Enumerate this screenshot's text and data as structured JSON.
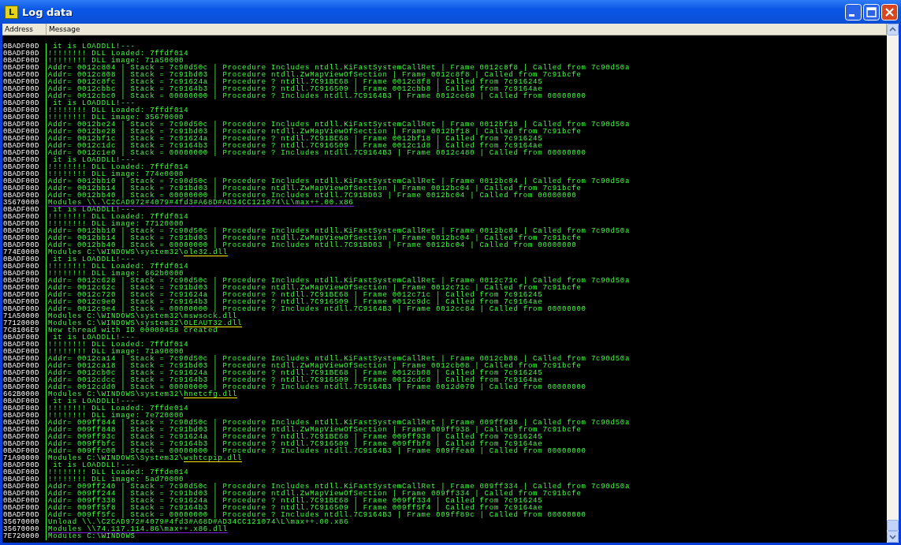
{
  "window": {
    "title": "Log data",
    "icon_letter": "L"
  },
  "columns": [
    "Address",
    "Message"
  ],
  "rows": [
    {
      "address": "0BADF00D",
      "message": " it is LOADDLL!---"
    },
    {
      "address": "0BADF00D",
      "message": "!!!!!!!! DLL Loaded: 7ffdf014"
    },
    {
      "address": "0BADF00D",
      "message": "!!!!!!!! DLL image: 71a50000"
    },
    {
      "address": "0BADF00D",
      "message": "Addr= 0012c804 | Stack = 7c90d50c | Procedure Includes ntdll.KiFastSystemCallRet | Frame 0012c8f8 | Called from 7c90d50a"
    },
    {
      "address": "0BADF00D",
      "message": "Addr= 0012c808 | Stack = 7c91bd03 | Procedure ntdll.ZwMapViewOfSection | Frame 0012c8f8 | Called from 7c91bcfe"
    },
    {
      "address": "0BADF00D",
      "message": "Addr= 0012c8fc | Stack = 7c91624a | Procedure ? ntdll.7C91BE68 | Frame 0012c8f8 | Called from 7c916245"
    },
    {
      "address": "0BADF00D",
      "message": "Addr= 0012cbbc | Stack = 7c9164b3 | Procedure ? ntdll.7C916509 | Frame 0012cbb8 | Called from 7c9164ae"
    },
    {
      "address": "0BADF00D",
      "message": "Addr= 0012cbc0 | Stack = 00000000 | Procedure ? Includes ntdll.7C9164B3 | Frame 0012ce60 | Called from 00000000"
    },
    {
      "address": "0BADF00D",
      "message": " it is LOADDLL!---"
    },
    {
      "address": "0BADF00D",
      "message": "!!!!!!!! DLL Loaded: 7ffdf014"
    },
    {
      "address": "0BADF00D",
      "message": "!!!!!!!! DLL image: 35670000"
    },
    {
      "address": "0BADF00D",
      "message": "Addr= 0012be24 | Stack = 7c90d50c | Procedure Includes ntdll.KiFastSystemCallRet | Frame 0012bf18 | Called from 7c90d50a"
    },
    {
      "address": "0BADF00D",
      "message": "Addr= 0012be28 | Stack = 7c91bd03 | Procedure ntdll.ZwMapViewOfSection | Frame 0012bf18 | Called from 7c91bcfe"
    },
    {
      "address": "0BADF00D",
      "message": "Addr= 0012bf1c | Stack = 7c91624a | Procedure ? ntdll.7C91BE68 | Frame 0012bf18 | Called from 7c916245"
    },
    {
      "address": "0BADF00D",
      "message": "Addr= 0012c1dc | Stack = 7c9164b3 | Procedure ? ntdll.7C916509 | Frame 0012c1d8 | Called from 7c9164ae"
    },
    {
      "address": "0BADF00D",
      "message": "Addr= 0012c1e0 | Stack = 00000000 | Procedure ? Includes ntdll.7C9164B3 | Frame 0012c480 | Called from 00000000"
    },
    {
      "address": "0BADF00D",
      "message": " it is LOADDLL!---"
    },
    {
      "address": "0BADF00D",
      "message": "!!!!!!!! DLL Loaded: 7ffdf014"
    },
    {
      "address": "0BADF00D",
      "message": "!!!!!!!! DLL image: 774e0000"
    },
    {
      "address": "0BADF00D",
      "message": "Addr= 0012bb10 | Stack = 7c90d50c | Procedure Includes ntdll.KiFastSystemCallRet | Frame 0012bc04 | Called from 7c90d50a"
    },
    {
      "address": "0BADF00D",
      "message": "Addr= 0012bb14 | Stack = 7c91bd03 | Procedure ntdll.ZwMapViewOfSection | Frame 0012bc04 | Called from 7c91bcfe"
    },
    {
      "address": "0BADF00D",
      "message": "Addr= 0012bb40 | Stack = 00000000 | Procedure Includes ntdll.7C91BD03 | Frame 0012bc04 | Called from 00000000"
    },
    {
      "address": "35670000",
      "message": "",
      "marked": "Modules \\\\.\\C2CAD972#4079#4fd3#A68D#AD34CC121074\\L\\max++.00.x86",
      "color": "#7a1fe0"
    },
    {
      "address": "0BADF00D",
      "message": " it is LOADDLL!---"
    },
    {
      "address": "0BADF00D",
      "message": "!!!!!!!! DLL Loaded: 7ffdf014"
    },
    {
      "address": "0BADF00D",
      "message": "!!!!!!!! DLL image: 77120000"
    },
    {
      "address": "0BADF00D",
      "message": "Addr= 0012bb10 | Stack = 7c90d50c | Procedure Includes ntdll.KiFastSystemCallRet | Frame 0012bc04 | Called from 7c90d50a"
    },
    {
      "address": "0BADF00D",
      "message": "Addr= 0012bb14 | Stack = 7c91bd03 | Procedure ntdll.ZwMapViewOfSection | Frame 0012bc04 | Called from 7c91bcfe"
    },
    {
      "address": "0BADF00D",
      "message": "Addr= 0012bb40 | Stack = 00000000 | Procedure Includes ntdll.7C91BD03 | Frame 0012bc04 | Called from 00000000"
    },
    {
      "address": "774E0000",
      "message": "Modules C:\\WINDOWS\\system32\\",
      "marked": "ole32.dll",
      "color": "#ffe600"
    },
    {
      "address": "0BADF00D",
      "message": " it is LOADDLL!---"
    },
    {
      "address": "0BADF00D",
      "message": "!!!!!!!! DLL Loaded: 7ffdf014"
    },
    {
      "address": "0BADF00D",
      "message": "!!!!!!!! DLL image: 662b0000"
    },
    {
      "address": "0BADF00D",
      "message": "Addr= 0012c628 | Stack = 7c90d50c | Procedure Includes ntdll.KiFastSystemCallRet | Frame 0012c71c | Called from 7c90d50a"
    },
    {
      "address": "0BADF00D",
      "message": "Addr= 0012c62c | Stack = 7c91bd03 | Procedure ntdll.ZwMapViewOfSection | Frame 0012c71c | Called from 7c91bcfe"
    },
    {
      "address": "0BADF00D",
      "message": "Addr= 0012c720 | Stack = 7c91624a | Procedure ? ntdll.7C91BE68 | Frame 0012c71c | Called from 7c916245"
    },
    {
      "address": "0BADF00D",
      "message": "Addr= 0012c9e0 | Stack = 7c9164b3 | Procedure ? ntdll.7C916509 | Frame 0012c9dc | Called from 7c9164ae"
    },
    {
      "address": "0BADF00D",
      "message": "Addr= 0012c9e4 | Stack = 00000000 | Procedure ? Includes ntdll.7C9164B3 | Frame 0012cc84 | Called from 00000000"
    },
    {
      "address": "71A50000",
      "message": "Modules C:\\WINDOWS\\system32\\mswsock.dll"
    },
    {
      "address": "77120000",
      "message": "Modules C:\\WINDOWS\\system32\\",
      "marked": "OLEAUT32.dll",
      "color": "#ffe600"
    },
    {
      "address": "7C8106E9",
      "message": "New thread with ID 00000458 created"
    },
    {
      "address": "0BADF00D",
      "message": " it is LOADDLL!---"
    },
    {
      "address": "0BADF00D",
      "message": "!!!!!!!! DLL Loaded: 7ffdf014"
    },
    {
      "address": "0BADF00D",
      "message": "!!!!!!!! DLL image: 71a90000"
    },
    {
      "address": "0BADF00D",
      "message": "Addr= 0012ca14 | Stack = 7c90d50c | Procedure Includes ntdll.KiFastSystemCallRet | Frame 0012cb08 | Called from 7c90d50a"
    },
    {
      "address": "0BADF00D",
      "message": "Addr= 0012ca18 | Stack = 7c91bd03 | Procedure ntdll.ZwMapViewOfSection | Frame 0012cb08 | Called from 7c91bcfe"
    },
    {
      "address": "0BADF00D",
      "message": "Addr= 0012cb0c | Stack = 7c91624a | Procedure ? ntdll.7C91BE68 | Frame 0012cb08 | Called from 7c916245"
    },
    {
      "address": "0BADF00D",
      "message": "Addr= 0012cdcc | Stack = 7c9164b3 | Procedure ? ntdll.7C916509 | Frame 0012cdc8 | Called from 7c9164ae"
    },
    {
      "address": "0BADF00D",
      "message": "Addr= 0012cdd0 | Stack = 00000000 | Procedure ? Includes ntdll.7C9164B3 | Frame 0012d070 | Called from 00000000"
    },
    {
      "address": "662B0000",
      "message": "Modules C:\\WINDOWS\\system32\\",
      "marked": "hnetcfg.dll",
      "color": "#ffe600"
    },
    {
      "address": "0BADF00D",
      "message": " it is LOADDLL!---"
    },
    {
      "address": "0BADF00D",
      "message": "!!!!!!!! DLL Loaded: 7ffde014"
    },
    {
      "address": "0BADF00D",
      "message": "!!!!!!!! DLL image: 7e720000"
    },
    {
      "address": "0BADF00D",
      "message": "Addr= 009ff844 | Stack = 7c90d50c | Procedure Includes ntdll.KiFastSystemCallRet | Frame 009ff938 | Called from 7c90d50a"
    },
    {
      "address": "0BADF00D",
      "message": "Addr= 009ff848 | Stack = 7c91bd03 | Procedure ntdll.ZwMapViewOfSection | Frame 009ff938 | Called from 7c91bcfe"
    },
    {
      "address": "0BADF00D",
      "message": "Addr= 009ff93c | Stack = 7c91624a | Procedure ? ntdll.7C91BE68 | Frame 009ff938 | Called from 7c916245"
    },
    {
      "address": "0BADF00D",
      "message": "Addr= 009ffbfc | Stack = 7c9164b3 | Procedure ? ntdll.7C916509 | Frame 009ffbf8 | Called from 7c9164ae"
    },
    {
      "address": "0BADF00D",
      "message": "Addr= 009ffc00 | Stack = 00000000 | Procedure ? Includes ntdll.7C9164B3 | Frame 009ffea0 | Called from 00000000"
    },
    {
      "address": "71A90000",
      "message": "Modules C:\\WINDOWS\\System32\\",
      "marked": "wshtcpip.dll",
      "color": "#ffe600"
    },
    {
      "address": "0BADF00D",
      "message": " it is LOADDLL!---"
    },
    {
      "address": "0BADF00D",
      "message": "!!!!!!!! DLL Loaded: 7ffde014"
    },
    {
      "address": "0BADF00D",
      "message": "!!!!!!!! DLL image: 5ad70000"
    },
    {
      "address": "0BADF00D",
      "message": "Addr= 009ff240 | Stack = 7c90d50c | Procedure Includes ntdll.KiFastSystemCallRet | Frame 009ff334 | Called from 7c90d50a"
    },
    {
      "address": "0BADF00D",
      "message": "Addr= 009ff244 | Stack = 7c91bd03 | Procedure ntdll.ZwMapViewOfSection | Frame 009ff334 | Called from 7c91bcfe"
    },
    {
      "address": "0BADF00D",
      "message": "Addr= 009ff338 | Stack = 7c91624a | Procedure ? ntdll.7C91BE68 | Frame 009ff334 | Called from 7c916245"
    },
    {
      "address": "0BADF00D",
      "message": "Addr= 009ff5f8 | Stack = 7c9164b3 | Procedure ? ntdll.7C916509 | Frame 009ff5f4 | Called from 7c9164ae"
    },
    {
      "address": "0BADF00D",
      "message": "Addr= 009ff5fc | Stack = 00000000 | Procedure ? Includes ntdll.7C9164B3 | Frame 009ff89c | Called from 00000000"
    },
    {
      "address": "35670000",
      "message": "Unload \\\\.\\C2CAD972#4079#4fd3#A68D#AD34CC121074\\L\\max++.00.x86"
    },
    {
      "address": "35670000",
      "message": "",
      "marked": "Modules \\\\74.117.114.86\\max++.x86.dll",
      "color": "#7a1fe0"
    },
    {
      "address": "7E720000",
      "message": "Modules C:\\WINDOWS"
    }
  ]
}
